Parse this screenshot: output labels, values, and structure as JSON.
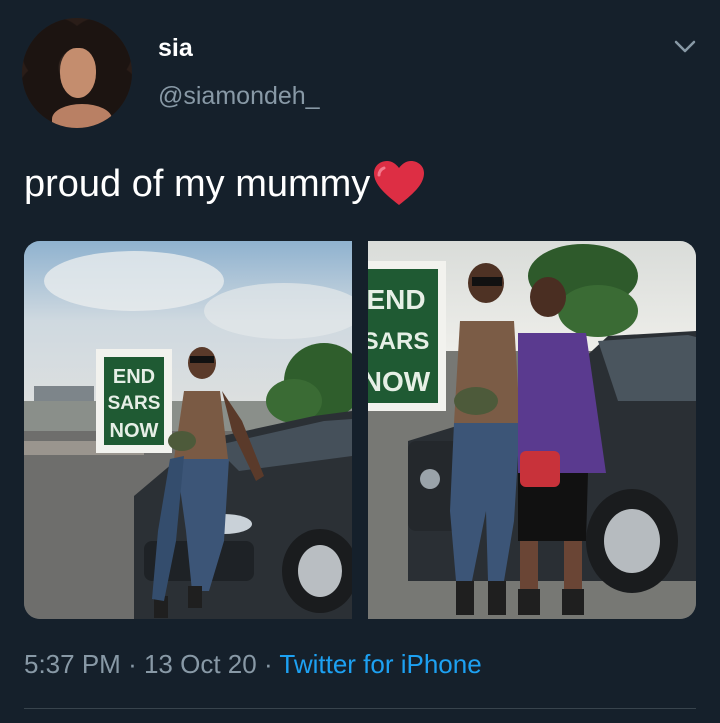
{
  "tweet": {
    "display_name": "sia",
    "handle": "@siamondeh_",
    "text": "proud of my mummy",
    "time": "5:37 PM",
    "separator": "·",
    "date": "13 Oct 20",
    "source": "Twitter for iPhone"
  },
  "icons": {
    "menu": "chevron-down-icon",
    "emoji": "red-heart-icon"
  },
  "sign_text": [
    "END",
    "SARS",
    "NOW"
  ],
  "colors": {
    "background": "#15202b",
    "secondary_text": "#8899a6",
    "link": "#1da1f2",
    "heart": "#e0245e"
  }
}
